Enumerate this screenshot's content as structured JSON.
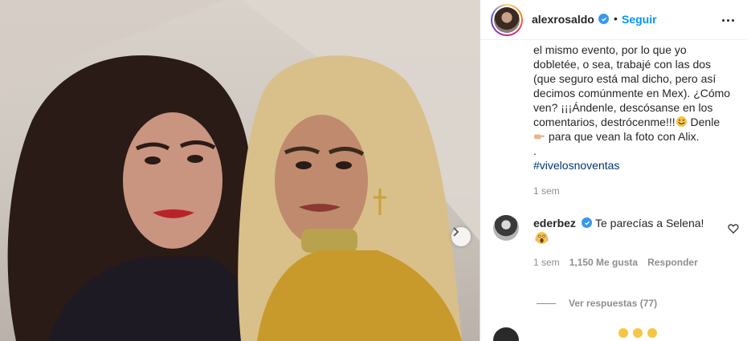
{
  "post": {
    "username": "alexrosaldo",
    "follow_label": "Seguir",
    "separator": "•",
    "caption_lines": [
      "el mismo evento, por lo que yo",
      "dobletée, o sea, trabajé con las dos",
      "(que seguro está mal dicho, pero así",
      "decimos comúnmente en Mex). ¿Cómo",
      "ven? ¡¡¡Ándenle, descósanse en los",
      "comentarios, destrócenme!!!",
      "Denle",
      "para que vean la foto con Alix.",
      "."
    ],
    "hashtag": "#vivelosnoventas",
    "time": "1 sem"
  },
  "icons": {
    "verified": "verified-badge-icon",
    "more": "more-options-icon",
    "next": "chevron-right-icon",
    "heart": "heart-outline-icon",
    "laugh": "rofl-emoji",
    "hand": "point-right-emoji",
    "scream": "scream-emoji"
  },
  "comment": {
    "username": "ederbez",
    "text": "Te parecías a Selena!",
    "time": "1 sem",
    "likes": "1,150 Me gusta",
    "reply_label": "Responder",
    "view_replies": "Ver respuestas (77)"
  },
  "colors": {
    "accent": "#0095f6",
    "verified": "#3897f0",
    "secondary_text": "#8e8e8e",
    "hashtag": "#00376b"
  }
}
